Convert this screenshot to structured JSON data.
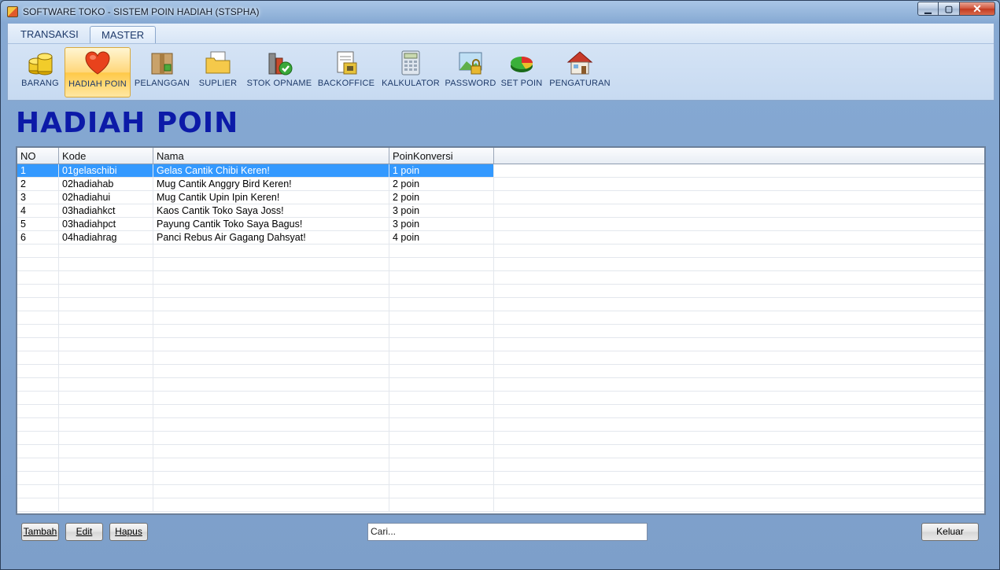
{
  "window": {
    "title": "SOFTWARE TOKO - SISTEM POIN HADIAH (STSPHA)"
  },
  "tabs": [
    {
      "label": "TRANSAKSI"
    },
    {
      "label": "MASTER"
    }
  ],
  "ribbon": {
    "items": [
      {
        "label": "BARANG",
        "icon": "coins-icon"
      },
      {
        "label": "HADIAH POIN",
        "icon": "heart-icon"
      },
      {
        "label": "PELANGGAN",
        "icon": "package-icon"
      },
      {
        "label": "SUPLIER",
        "icon": "folder-icon"
      },
      {
        "label": "STOK OPNAME",
        "icon": "stock-check-icon"
      },
      {
        "label": "BACKOFFICE",
        "icon": "backoffice-icon"
      },
      {
        "label": "KALKULATOR",
        "icon": "calculator-icon"
      },
      {
        "label": "PASSWORD",
        "icon": "password-lock-icon"
      },
      {
        "label": "SET POIN",
        "icon": "pie-chart-icon"
      },
      {
        "label": "PENGATURAN",
        "icon": "house-icon"
      }
    ]
  },
  "page": {
    "title": "HADIAH POIN"
  },
  "table": {
    "columns": [
      "NO",
      "Kode",
      "Nama",
      "PoinKonversi"
    ],
    "rows": [
      [
        "1",
        "01gelaschibi",
        "Gelas Cantik Chibi Keren!",
        "1 poin"
      ],
      [
        "2",
        "02hadiahab",
        "Mug Cantik Anggry Bird Keren!",
        "2 poin"
      ],
      [
        "3",
        "02hadiahui",
        "Mug Cantik Upin Ipin Keren!",
        "2 poin"
      ],
      [
        "4",
        "03hadiahkct",
        "Kaos Cantik Toko Saya Joss!",
        "3 poin"
      ],
      [
        "5",
        "03hadiahpct",
        "Payung Cantik Toko Saya Bagus!",
        "3 poin"
      ],
      [
        "6",
        "04hadiahrag",
        "Panci Rebus Air Gagang Dahsyat!",
        "4 poin"
      ]
    ]
  },
  "actions": {
    "tambah": "Tambah",
    "edit": "Edit",
    "hapus": "Hapus",
    "keluar": "Keluar"
  },
  "search": {
    "value": "Cari..."
  },
  "colors": {
    "title": "#0c1aa8",
    "selection": "#3399ff",
    "ribbon_selected": "#ffc948"
  }
}
